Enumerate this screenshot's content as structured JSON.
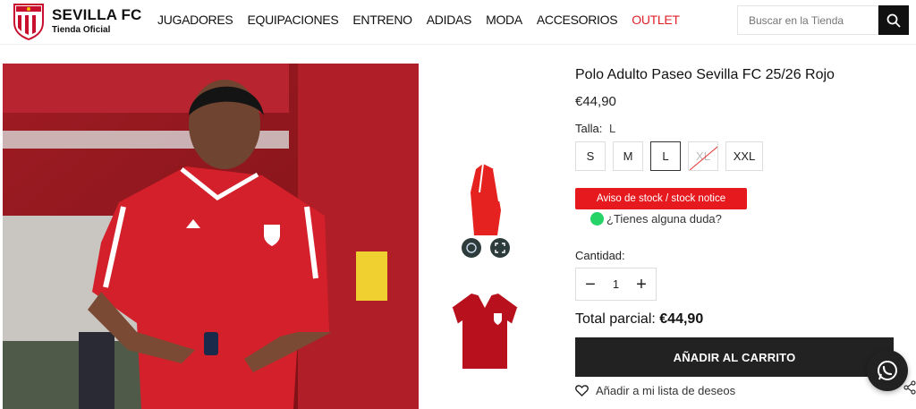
{
  "brand": {
    "name": "SEVILLA FC",
    "subtitle": "Tienda Oficial"
  },
  "nav": [
    {
      "label": "JUGADORES"
    },
    {
      "label": "EQUIPACIONES"
    },
    {
      "label": "ENTRENO"
    },
    {
      "label": "ADIDAS"
    },
    {
      "label": "MODA"
    },
    {
      "label": "ACCESORIOS"
    },
    {
      "label": "OUTLET"
    }
  ],
  "search": {
    "placeholder": "Buscar en la Tienda"
  },
  "product": {
    "title": "Polo Adulto Paseo Sevilla FC 25/26 Rojo",
    "price": "€44,90",
    "size_label": "Talla:",
    "selected_size": "L",
    "sizes": [
      {
        "label": "S",
        "available": true
      },
      {
        "label": "M",
        "available": true
      },
      {
        "label": "L",
        "available": true,
        "selected": true
      },
      {
        "label": "XL",
        "available": false
      },
      {
        "label": "XXL",
        "available": true
      }
    ],
    "stock_notice": "Aviso de stock / stock notice",
    "question": "¿Tienes alguna duda?",
    "quantity_label": "Cantidad:",
    "quantity": "1",
    "subtotal_label": "Total parcial:",
    "subtotal_value": "€44,90",
    "add_to_cart": "AÑADIR AL CARRITO",
    "wishlist": "Añadir a mi lista de deseos"
  },
  "colors": {
    "accent_red": "#e5191e",
    "outlet_red": "#e0202a",
    "dark": "#222222",
    "whatsapp_green": "#25d366"
  },
  "icons": [
    "search-icon",
    "whatsapp-icon",
    "heart-icon",
    "share-icon",
    "zoom-icon",
    "expand-icon",
    "minus-icon",
    "plus-icon"
  ]
}
